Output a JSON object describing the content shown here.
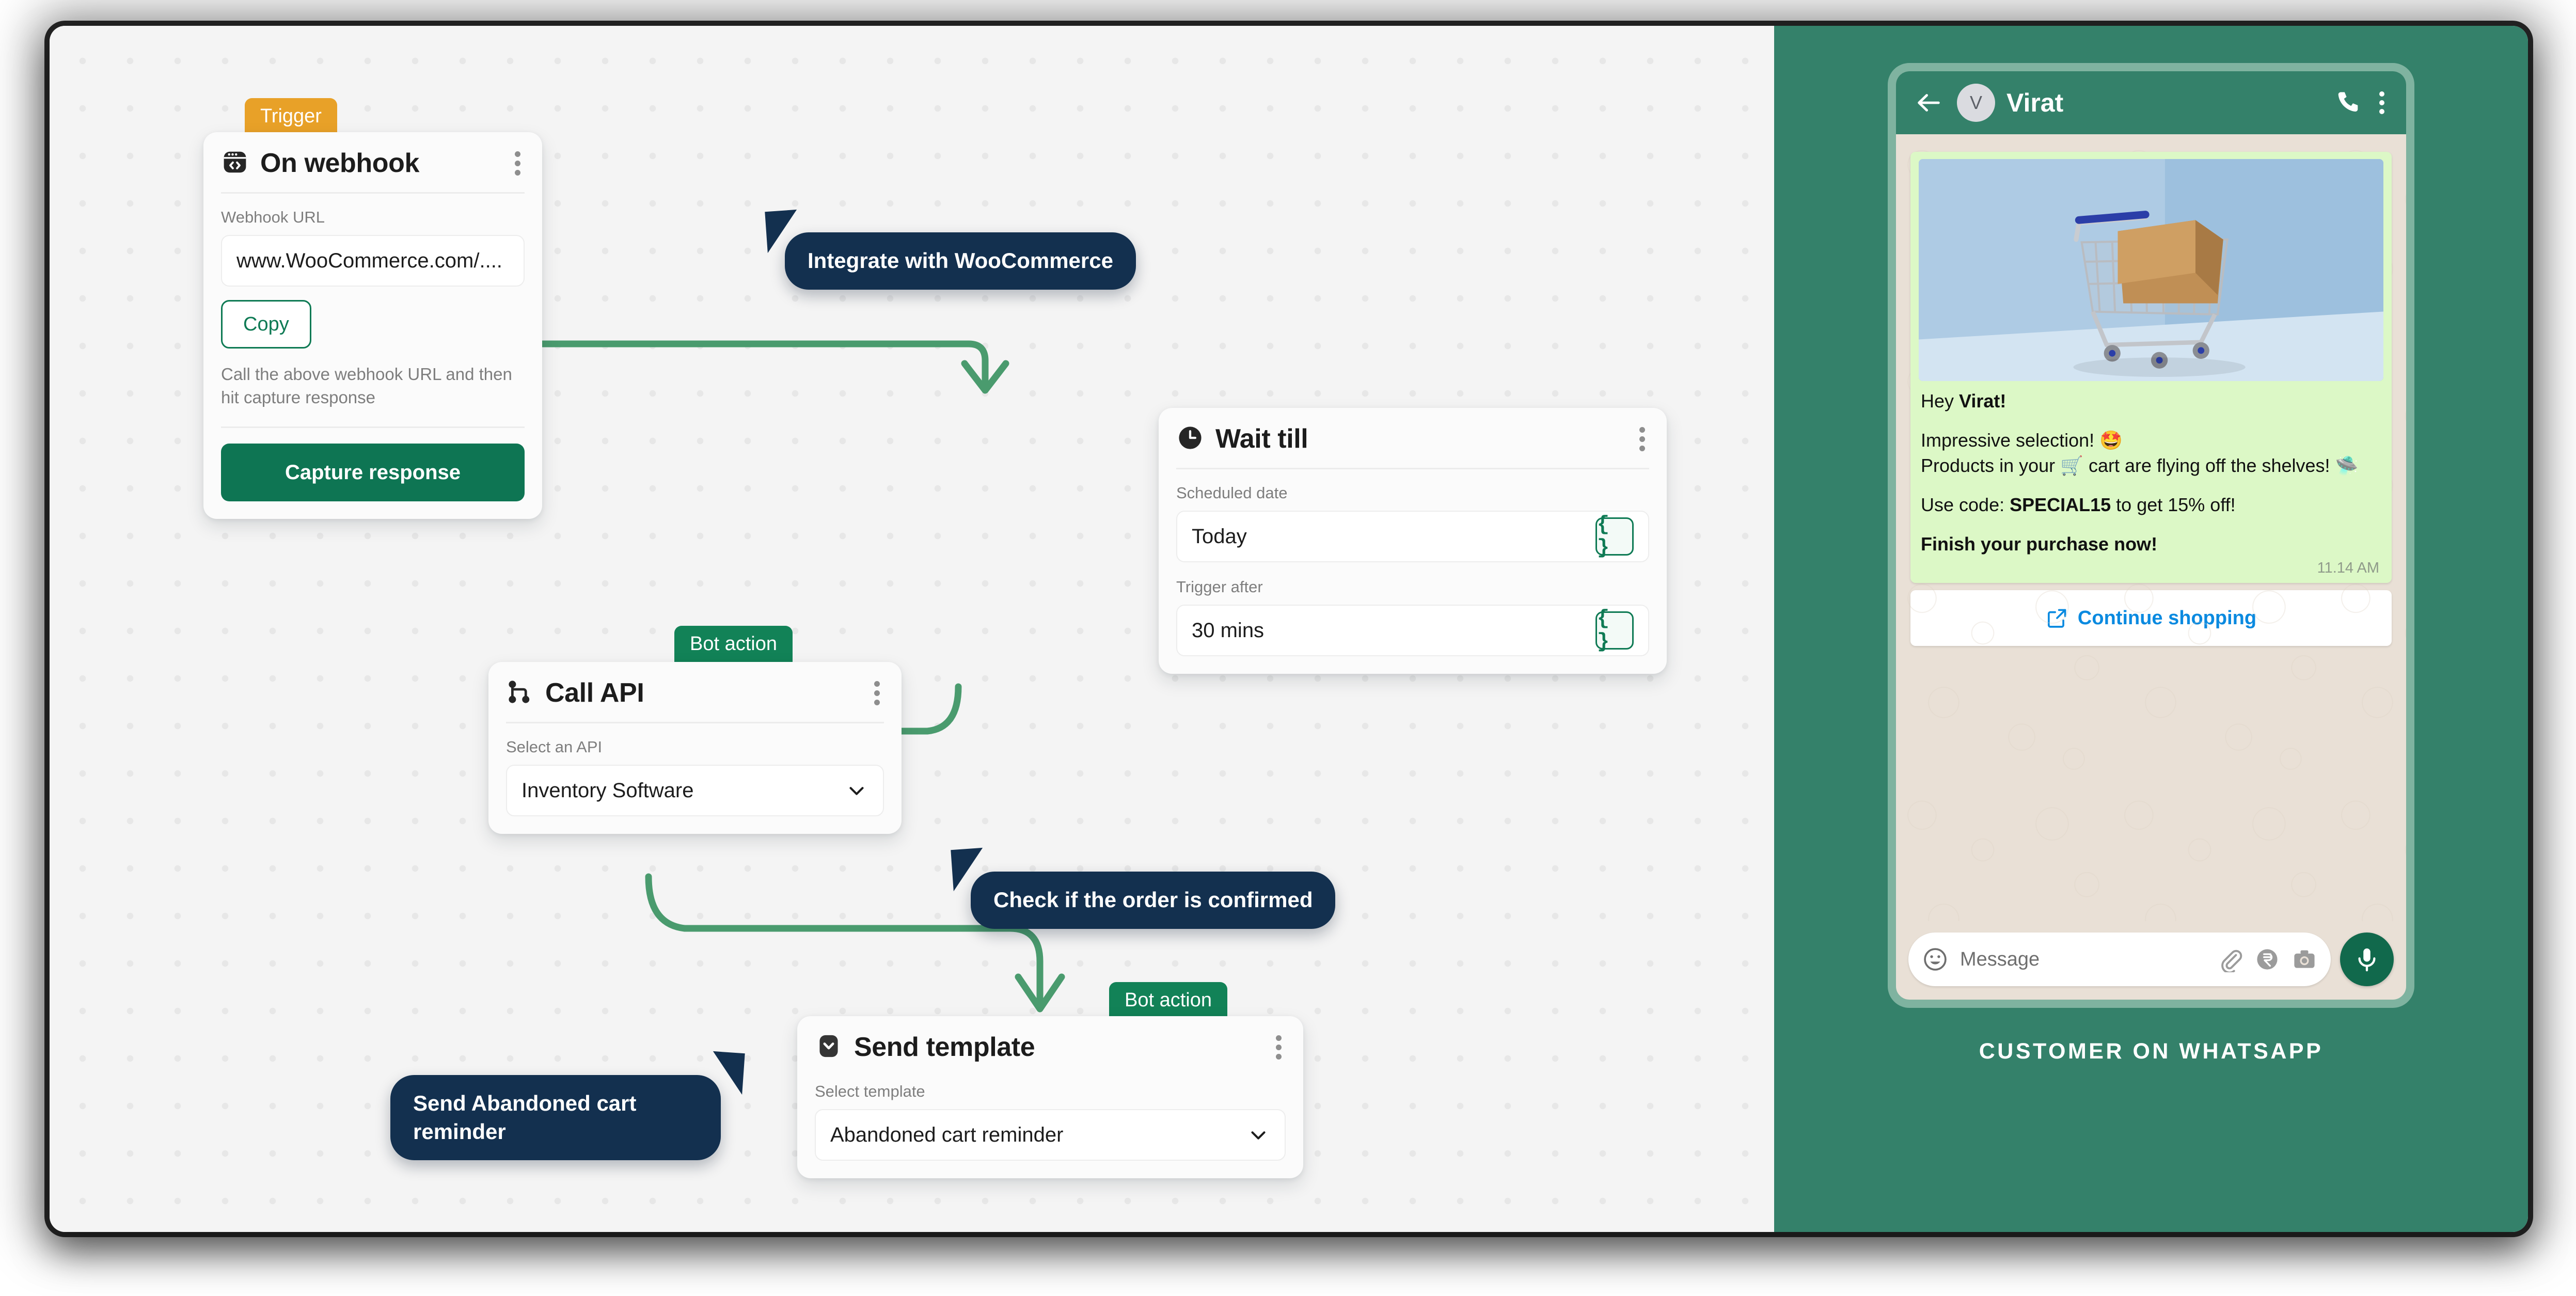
{
  "flow": {
    "nodes": [
      {
        "id": "on-webhook",
        "badge": "Trigger",
        "title": "On webhook",
        "icon": "webhook-code-icon",
        "field_label": "Webhook URL",
        "field_value": "www.WooCommerce.com/....",
        "copy_label": "Copy",
        "helper_text": "Call the above webhook URL and then hit capture response",
        "primary_label": "Capture response"
      },
      {
        "id": "wait-till",
        "title": "Wait till",
        "icon": "clock-icon",
        "field1_label": "Scheduled date",
        "field1_value": "Today",
        "field2_label": "Trigger after",
        "field2_value": "30 mins",
        "token_glyph": "{ }"
      },
      {
        "id": "call-api",
        "badge": "Bot action",
        "title": "Call API",
        "icon": "branch-node-icon",
        "field_label": "Select an API",
        "field_value": "Inventory Software"
      },
      {
        "id": "send-template",
        "badge": "Bot action",
        "title": "Send template",
        "icon": "chevron-square-icon",
        "field_label": "Select template",
        "field_value": "Abandoned cart reminder"
      }
    ],
    "callouts": [
      {
        "id": "callout-woocommerce",
        "text": "Integrate with WooCommerce"
      },
      {
        "id": "callout-order-confirmed",
        "text": "Check if the order is confirmed"
      },
      {
        "id": "callout-abandoned-cart",
        "text": "Send Abandoned cart reminder"
      }
    ]
  },
  "whatsapp": {
    "contact_name": "Virat",
    "avatar_initial": "V",
    "message": {
      "greeting_prefix": "Hey ",
      "greeting_name": "Virat!",
      "line_a": "Impressive selection! 🤩",
      "line_b": "Products in your 🛒 cart are flying off the shelves! 🛸",
      "promo_prefix": "Use code: ",
      "promo_code": "SPECIAL15",
      "promo_suffix": " to get 15% off!",
      "closing": "Finish your purchase now!",
      "timestamp": "11.14 AM"
    },
    "cta_label": "Continue shopping",
    "composer_placeholder": "Message",
    "caption": "CUSTOMER ON WHATSAPP"
  },
  "colors": {
    "panel_green": "#34816a",
    "accent_green": "#0e7553",
    "connector_green": "#4a9b6e",
    "trigger_orange": "#e8a128",
    "bot_green": "#128257",
    "callout_navy": "#13304f",
    "link_blue": "#0a8ae0",
    "bubble_green": "#dcf8c6"
  }
}
